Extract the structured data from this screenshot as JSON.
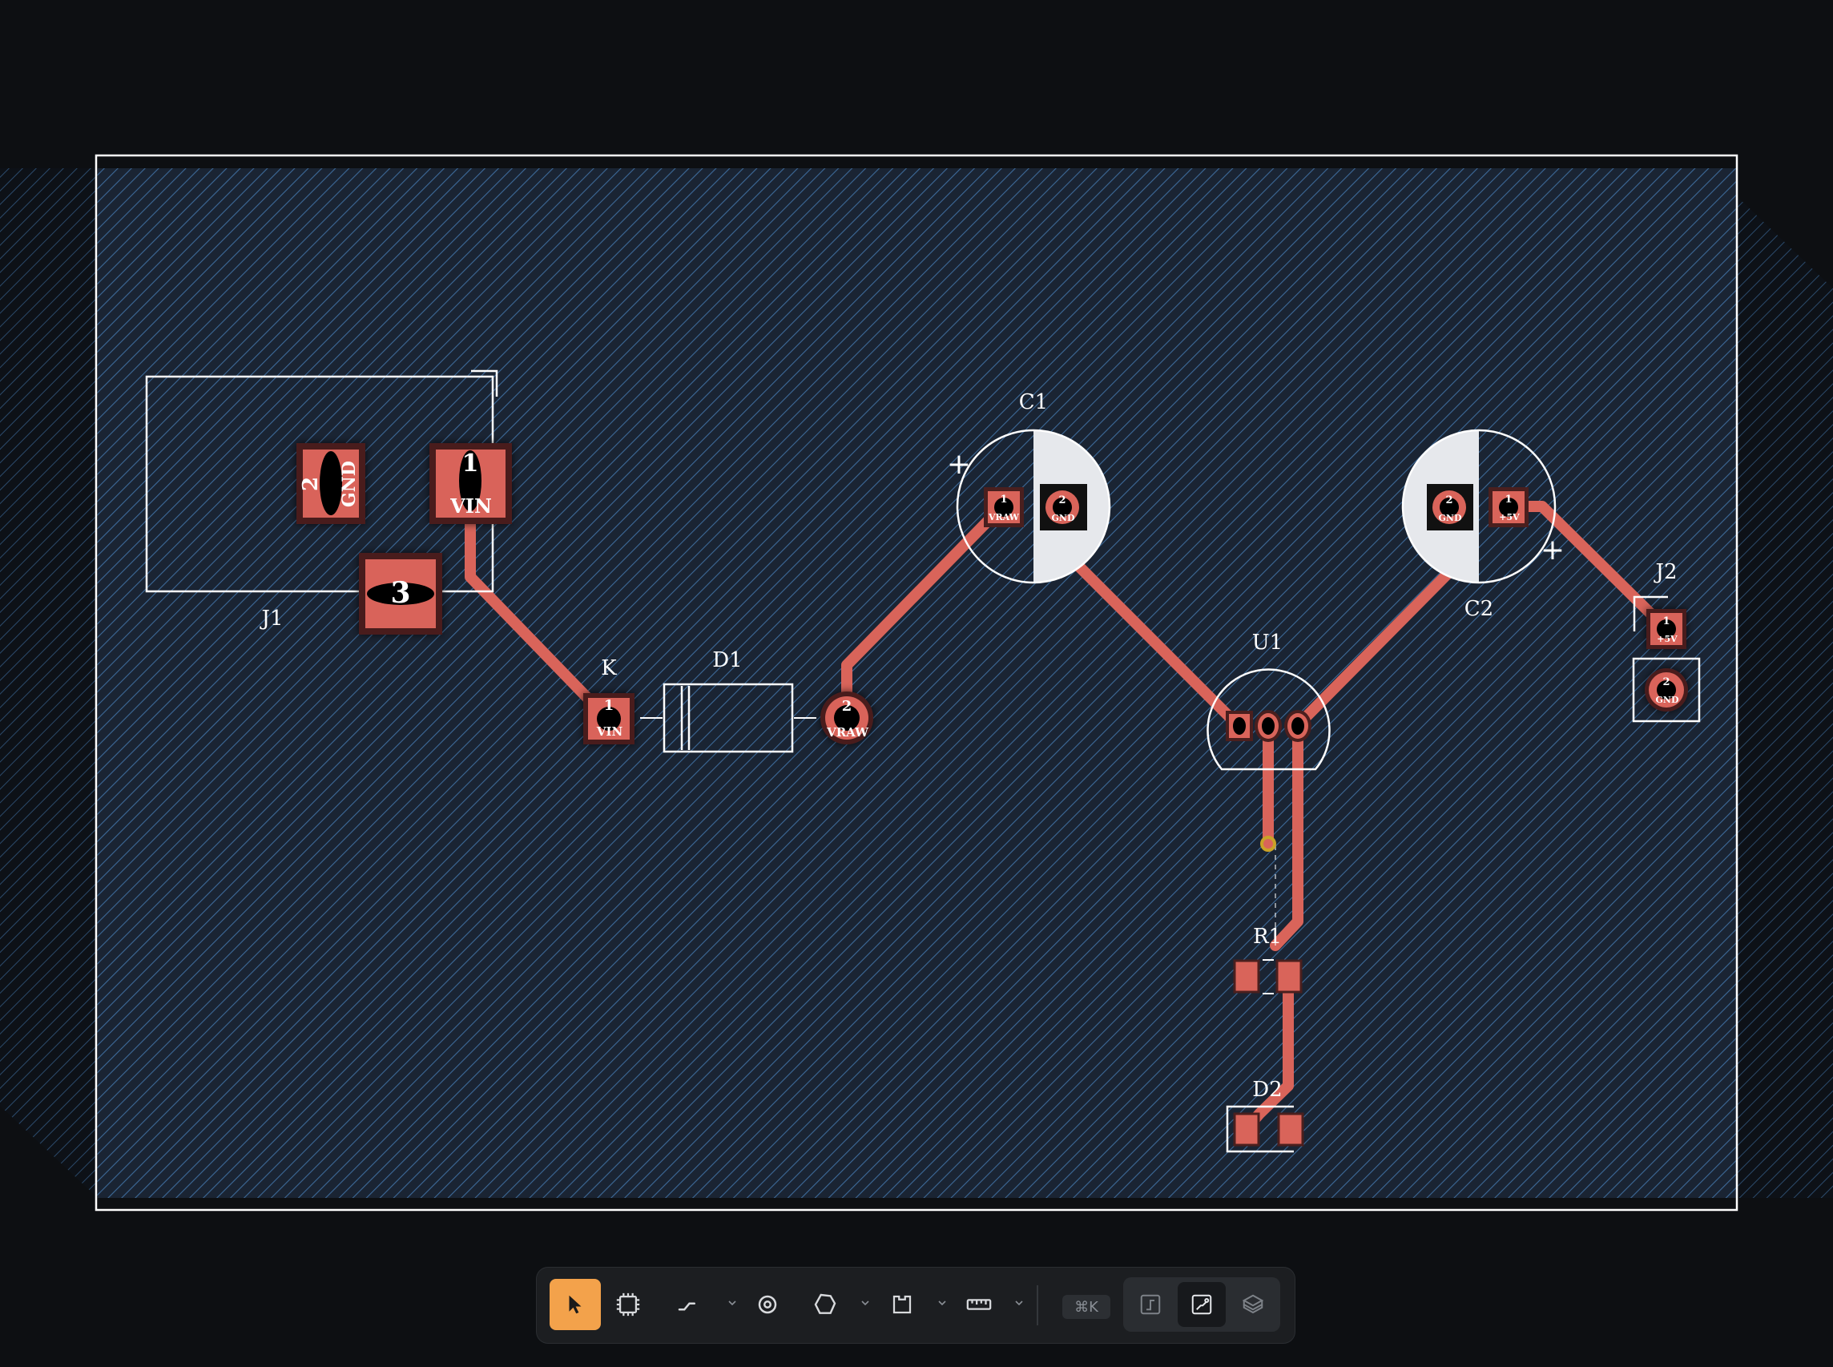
{
  "board": {
    "components": {
      "J1": {
        "ref": "J1",
        "pads": [
          {
            "num": "2",
            "net": "GND"
          },
          {
            "num": "1",
            "net": "VIN"
          },
          {
            "num": "3"
          }
        ]
      },
      "K": {
        "ref": "K",
        "pad": {
          "num": "1",
          "net": "VIN"
        }
      },
      "D1": {
        "ref": "D1",
        "pad": {
          "num": "2",
          "net": "VRAW"
        }
      },
      "C1": {
        "ref": "C1",
        "pads": [
          {
            "num": "1",
            "net": "VRAW"
          },
          {
            "num": "2",
            "net": "GND"
          }
        ],
        "polarity": "+"
      },
      "C2": {
        "ref": "C2",
        "pads": [
          {
            "num": "2",
            "net": "GND"
          },
          {
            "num": "1",
            "net": "+5V"
          }
        ],
        "polarity": "+"
      },
      "U1": {
        "ref": "U1"
      },
      "R1": {
        "ref": "R1"
      },
      "D2": {
        "ref": "D2"
      },
      "J2": {
        "ref": "J2",
        "pads": [
          {
            "num": "1",
            "net": "+5V"
          },
          {
            "num": "2",
            "net": "GND"
          }
        ]
      }
    }
  },
  "toolbar": {
    "tools": [
      {
        "id": "select",
        "icon": "pointer-icon",
        "active": true
      },
      {
        "id": "footprint",
        "icon": "chip-icon"
      },
      {
        "id": "route",
        "icon": "route-icon"
      },
      {
        "id": "via",
        "icon": "via-icon"
      },
      {
        "id": "zone",
        "icon": "polygon-icon"
      },
      {
        "id": "board-outline",
        "icon": "outline-icon"
      },
      {
        "id": "measure",
        "icon": "ruler-icon"
      }
    ],
    "shortcut_label": "⌘K",
    "views": [
      {
        "id": "schematic",
        "icon": "schematic-view-icon",
        "active": false
      },
      {
        "id": "pcb",
        "icon": "pcb-view-icon",
        "active": true
      },
      {
        "id": "3d",
        "icon": "3d-view-icon",
        "active": false
      }
    ]
  },
  "colors": {
    "background": "#0d0f12",
    "board_fill": "#1a2535",
    "hatch": "#3d6a99",
    "copper": "#d9645a",
    "silkscreen": "#ffffff",
    "accent": "#f3a24b",
    "via": "#c9a227"
  }
}
